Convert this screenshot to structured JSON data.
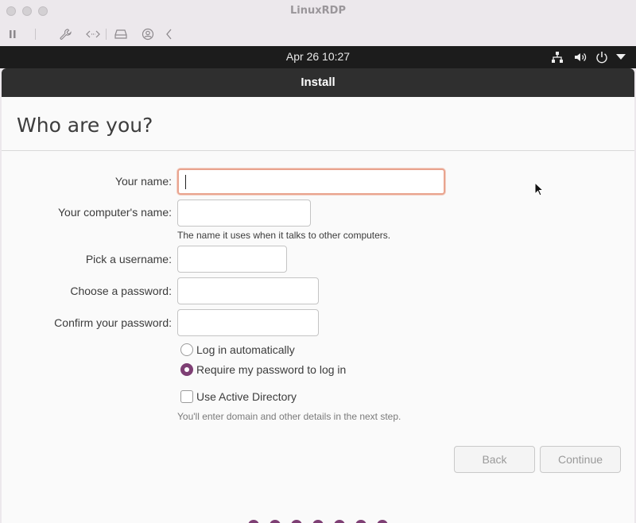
{
  "mac_window": {
    "title": "LinuxRDP",
    "toolbar_icons": [
      "pause-icon",
      "wrench-icon",
      "code-arrows-icon",
      "drive-icon",
      "user-icon",
      "chevron-left-icon"
    ]
  },
  "topbar": {
    "clock": "Apr 26  10:27",
    "icons": [
      "network-icon",
      "volume-icon",
      "power-icon",
      "dropdown-arrow-icon"
    ]
  },
  "installer": {
    "window_title": "Install",
    "page_title": "Who are you?",
    "fields": {
      "name": {
        "label": "Your name:",
        "value": ""
      },
      "computer": {
        "label": "Your computer's name:",
        "value": "",
        "hint": "The name it uses when it talks to other computers."
      },
      "username": {
        "label": "Pick a username:",
        "value": ""
      },
      "password": {
        "label": "Choose a password:",
        "value": ""
      },
      "confirm": {
        "label": "Confirm your password:",
        "value": ""
      }
    },
    "login_options": {
      "auto": {
        "label": "Log in automatically",
        "selected": false
      },
      "require": {
        "label": "Require my password to log in",
        "selected": true
      }
    },
    "active_directory": {
      "label": "Use Active Directory",
      "checked": false,
      "hint": "You'll enter domain and other details in the next step."
    },
    "buttons": {
      "back": "Back",
      "continue": "Continue"
    },
    "progress_dots": 7
  },
  "colors": {
    "accent": "#7e3f74",
    "focus_border": "#e9a48f",
    "header_bg": "#2f2f2f",
    "topbar_bg": "#1c1c1c"
  }
}
